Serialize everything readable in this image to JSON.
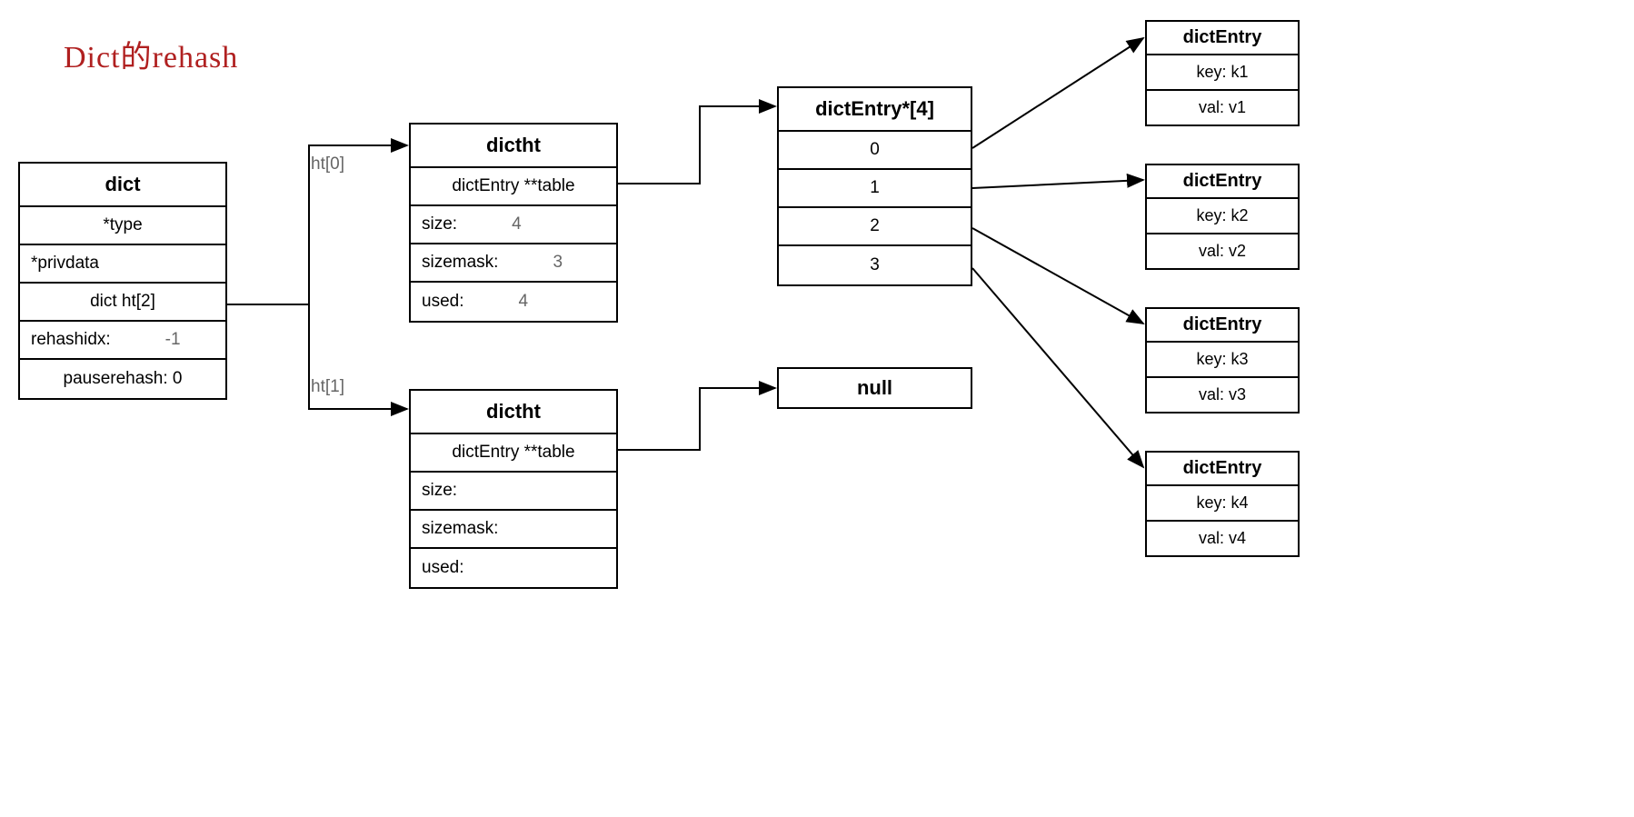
{
  "title": "Dict的rehash",
  "dict": {
    "header": "dict",
    "type": "*type",
    "privdata": "*privdata",
    "ht": "dict ht[2]",
    "rehashidx_label": "rehashidx:",
    "rehashidx_value": "-1",
    "pauserehash": "pauserehash: 0"
  },
  "edge_labels": {
    "ht0": "ht[0]",
    "ht1": "ht[1]"
  },
  "dictht0": {
    "header": "dictht",
    "table": "dictEntry **table",
    "size_label": "size:",
    "size_value": "4",
    "sizemask_label": "sizemask:",
    "sizemask_value": "3",
    "used_label": "used:",
    "used_value": "4"
  },
  "dictht1": {
    "header": "dictht",
    "table": "dictEntry **table",
    "size_label": "size:",
    "size_value": "",
    "sizemask_label": "sizemask:",
    "sizemask_value": "",
    "used_label": "used:",
    "used_value": ""
  },
  "entry_array": {
    "header": "dictEntry*[4]",
    "slots": [
      "0",
      "1",
      "2",
      "3"
    ]
  },
  "null_label": "null",
  "entries": [
    {
      "header": "dictEntry",
      "key": "key: k1",
      "val": "val: v1"
    },
    {
      "header": "dictEntry",
      "key": "key: k2",
      "val": "val: v2"
    },
    {
      "header": "dictEntry",
      "key": "key: k3",
      "val": "val: v3"
    },
    {
      "header": "dictEntry",
      "key": "key: k4",
      "val": "val: v4"
    }
  ]
}
